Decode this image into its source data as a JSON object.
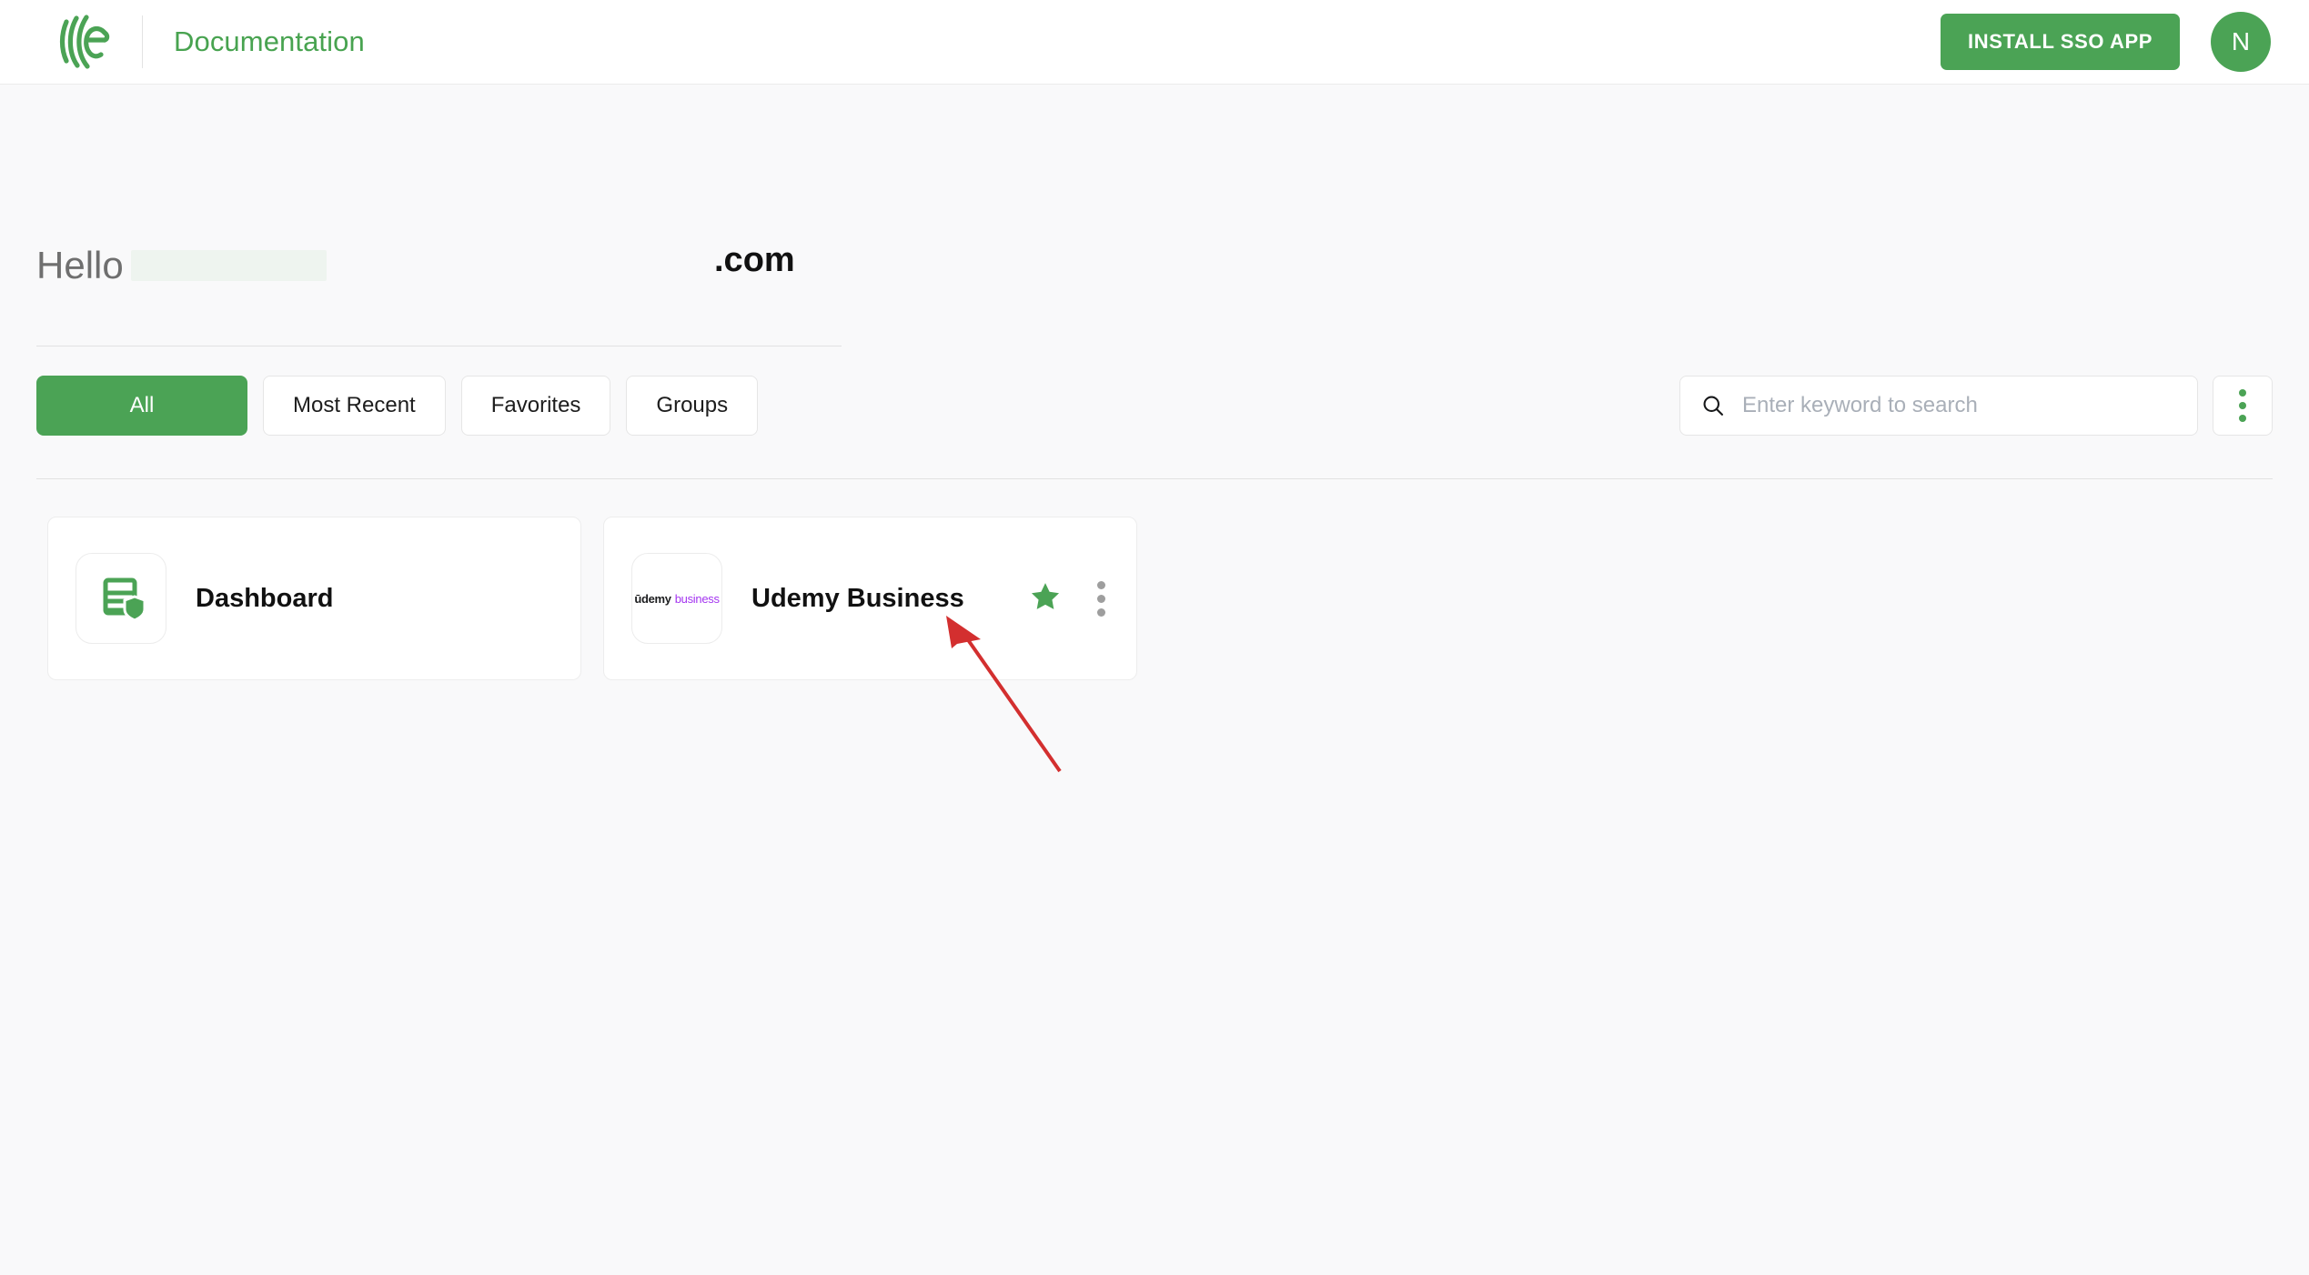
{
  "header": {
    "logo_icon": "eperi-arcs-logo",
    "title": "Documentation",
    "install_button_label": "INSTALL SSO APP",
    "avatar_initial": "N",
    "accent_color": "#4ba355"
  },
  "greeting": {
    "hello_label": "Hello",
    "redacted_name": "",
    "domain_suffix": ".com"
  },
  "filters": {
    "tabs": [
      {
        "label": "All",
        "active": true
      },
      {
        "label": "Most Recent",
        "active": false
      },
      {
        "label": "Favorites",
        "active": false
      },
      {
        "label": "Groups",
        "active": false
      }
    ],
    "more_options_icon": "kebab-menu-icon"
  },
  "search": {
    "icon": "search-icon",
    "placeholder": "Enter keyword to search",
    "value": ""
  },
  "apps": [
    {
      "name": "Dashboard",
      "icon": "document-shield-icon",
      "favorite": false,
      "has_menu": false
    },
    {
      "name": "Udemy Business",
      "icon": "udemy-business-logo",
      "logo_text_primary": "ūdemy",
      "logo_text_secondary": "business",
      "favorite": true,
      "favorite_icon": "star-filled-icon",
      "menu_icon": "kebab-menu-icon",
      "has_menu": true
    }
  ],
  "annotation": {
    "type": "arrow",
    "color": "#d32f2f",
    "points_to": "favorite-star"
  }
}
